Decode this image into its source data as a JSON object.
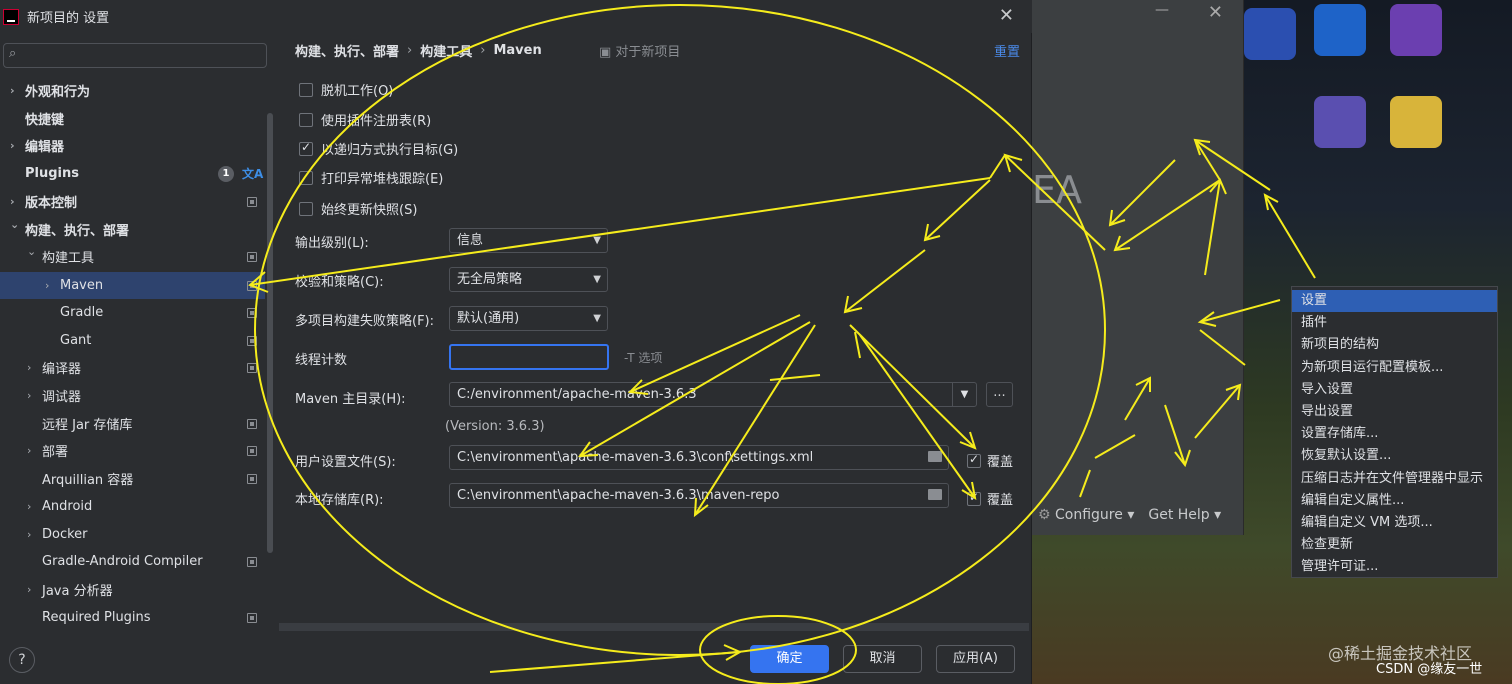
{
  "dialog": {
    "title": "新项目的 设置",
    "close_icon": "close-icon"
  },
  "sidebar": {
    "search_placeholder": "",
    "items": [
      {
        "label": "外观和行为",
        "arrow": "›"
      },
      {
        "label": "快捷键",
        "arrow": ""
      },
      {
        "label": "编辑器",
        "arrow": "›"
      },
      {
        "label": "Plugins",
        "arrow": "",
        "badge": "1"
      },
      {
        "label": "版本控制",
        "arrow": "›"
      },
      {
        "label": "构建、执行、部署",
        "arrow": "⌄"
      },
      {
        "label": "构建工具",
        "arrow": "⌄"
      },
      {
        "label": "Maven",
        "arrow": "›"
      },
      {
        "label": "Gradle",
        "arrow": ""
      },
      {
        "label": "Gant",
        "arrow": ""
      },
      {
        "label": "编译器",
        "arrow": "›"
      },
      {
        "label": "调试器",
        "arrow": "›"
      },
      {
        "label": "远程 Jar 存储库",
        "arrow": ""
      },
      {
        "label": "部署",
        "arrow": "›"
      },
      {
        "label": "Arquillian 容器",
        "arrow": ""
      },
      {
        "label": "Android",
        "arrow": "›"
      },
      {
        "label": "Docker",
        "arrow": "›"
      },
      {
        "label": "Gradle-Android Compiler",
        "arrow": ""
      },
      {
        "label": "Java 分析器",
        "arrow": "›"
      },
      {
        "label": "Required Plugins",
        "arrow": ""
      }
    ],
    "translate_icon": "文A",
    "help": "?"
  },
  "main": {
    "breadcrumb": [
      "构建、执行、部署",
      "构建工具",
      "Maven"
    ],
    "breadcrumb_sep": "›",
    "for_new_project": "对于新项目",
    "reset": "重置",
    "checkboxes": [
      {
        "label": "脱机工作(O)",
        "checked": false
      },
      {
        "label": "使用插件注册表(R)",
        "checked": false
      },
      {
        "label": "以递归方式执行目标(G)",
        "checked": true
      },
      {
        "label": "打印异常堆栈跟踪(E)",
        "checked": false
      },
      {
        "label": "始终更新快照(S)",
        "checked": false
      }
    ],
    "output_level_label": "输出级别(L):",
    "output_level_value": "信息",
    "checksum_label": "校验和策略(C):",
    "checksum_value": "无全局策略",
    "multiproject_label": "多项目构建失败策略(F):",
    "multiproject_value": "默认(通用)",
    "thread_label": "线程计数",
    "thread_value": "",
    "thread_hint": "-T 选项",
    "maven_home_label": "Maven 主目录(H):",
    "maven_home_value": "C:/environment/apache-maven-3.6.3",
    "maven_browse": "...",
    "version": "(Version: 3.6.3)",
    "user_settings_label": "用户设置文件(S):",
    "user_settings_value": "C:\\environment\\apache-maven-3.6.3\\conf\\settings.xml",
    "local_repo_label": "本地存储库(R):",
    "local_repo_value": "C:\\environment\\apache-maven-3.6.3\\maven-repo",
    "override": "覆盖"
  },
  "buttons": {
    "ok": "确定",
    "cancel": "取消",
    "apply": "应用(A)"
  },
  "welcome": {
    "big_text": "EA",
    "configure": "Configure",
    "get_help": "Get Help",
    "close": "✕",
    "minimize": "—"
  },
  "context_menu": [
    "设置",
    "插件",
    "新项目的结构",
    "为新项目运行配置模板...",
    "导入设置",
    "导出设置",
    "设置存储库...",
    "恢复默认设置...",
    "压缩日志并在文件管理器中显示",
    "编辑自定义属性...",
    "编辑自定义 VM 选项...",
    "检查更新",
    "管理许可证..."
  ],
  "watermark": {
    "line1": "@稀土掘金技术社区",
    "line2": "CSDN @缘友一世"
  },
  "colors": {
    "accent": "#3574f0",
    "annotation": "#f5ec1c",
    "link": "#4b8bea",
    "selected": "#2e436e"
  }
}
